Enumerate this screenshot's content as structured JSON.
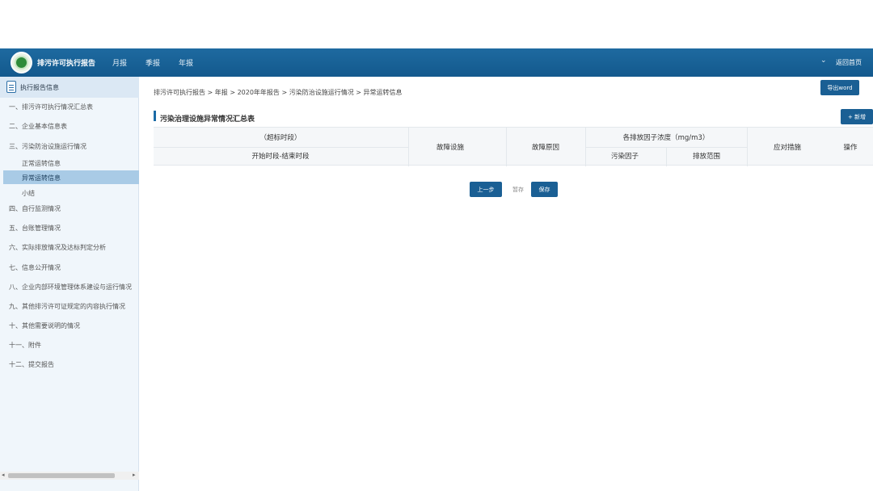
{
  "header": {
    "app_title": "排污许可执行报告",
    "nav": [
      "月报",
      "季报",
      "年报"
    ],
    "chevron": "⌄",
    "home_link": "返回首页"
  },
  "sidebar": {
    "head_label": "执行报告信息",
    "items": [
      "一、排污许可执行情况汇总表",
      "二、企业基本信息表",
      "三、污染防治设施运行情况",
      "四、自行监测情况",
      "五、台账管理情况",
      "六、实际排放情况及达标判定分析",
      "七、信息公开情况",
      "八、企业内部环境管理体系建设与运行情况",
      "九、其他排污许可证规定的内容执行情况",
      "十、其他需要说明的情况",
      "十一、附件",
      "十二、提交报告"
    ],
    "sub_items": [
      "正常运转信息",
      "异常运转信息",
      "小结"
    ]
  },
  "main": {
    "breadcrumb": "排污许可执行报告 > 年报 > 2020年年报告 > 污染防治设施运行情况 > 异常运转信息",
    "export_label": "导出word",
    "section_title": "污染治理设施异常情况汇总表",
    "add_label": "+ 新增",
    "table": {
      "col_period_top": "（超标时段）",
      "col_period_bottom": "开始时段-结束时段",
      "col_facility": "故障设施",
      "col_reason": "故障原因",
      "col_conc_group": "各排放因子浓度（mg/m3）",
      "col_factor": "污染因子",
      "col_range": "排放范围",
      "col_measures": "应对措施",
      "col_action": "操作"
    },
    "buttons": {
      "prev": "上一步",
      "draft": "暂存",
      "save": "保存"
    }
  },
  "scroll": {
    "left": "◂",
    "right": "▸"
  },
  "colors": {
    "header": "#13598d",
    "accent": "#1a5f94",
    "sidebar_active": "#a9cbe6"
  }
}
